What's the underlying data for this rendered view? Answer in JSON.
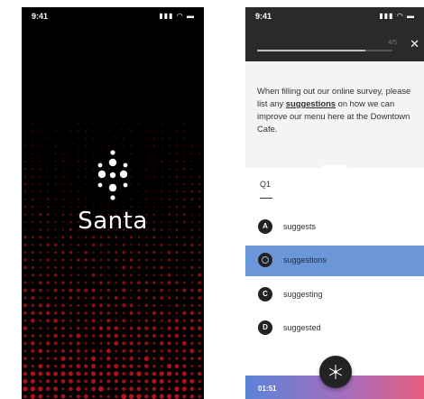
{
  "screens": {
    "splash": {
      "status_time": "9:41",
      "status_icons": "signal-wifi-battery",
      "brand_name": "Santa",
      "background": "#000000",
      "dot_color": "#d0141c"
    },
    "quiz": {
      "status_time": "9:41",
      "status_icons": "signal-wifi-battery",
      "progress_label": "4/5",
      "progress": 0.8,
      "close_icon": "close-icon",
      "question_before": "When filling out our online survey, please list any ",
      "question_highlight": "suggestions",
      "question_after": " on how we can improve our menu here at the Downtown Cafe.",
      "question_number": "Q1",
      "options": [
        {
          "letter": "A",
          "text": "suggests",
          "selected": false
        },
        {
          "letter": "",
          "text": "suggestions",
          "selected": true
        },
        {
          "letter": "C",
          "text": "suggesting",
          "selected": false
        },
        {
          "letter": "D",
          "text": "suggested",
          "selected": false
        }
      ],
      "timer": "01:51",
      "fab_icon": "snowflake-icon",
      "accent_colors": {
        "selected": "#6b96d8",
        "gradient_start": "#5c83d8",
        "gradient_end": "#e65e7f"
      }
    }
  }
}
